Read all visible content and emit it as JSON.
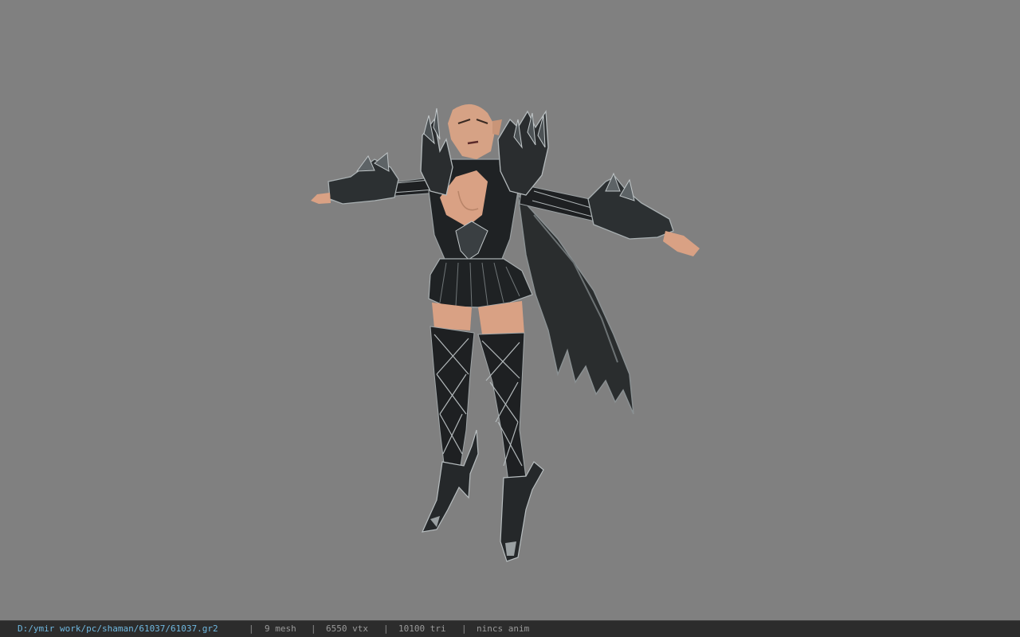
{
  "viewport": {
    "background_color": "#808080"
  },
  "statusbar": {
    "file_path": "D:/ymir work/pc/shaman/61037/61037.gr2",
    "mesh_count": "9 mesh",
    "vertex_count": "6550 vtx",
    "triangle_count": "10100 tri",
    "anim_status": "nincs anim",
    "separator": "|",
    "path_color": "#6fb8e0",
    "text_color": "#9a9a9a"
  }
}
